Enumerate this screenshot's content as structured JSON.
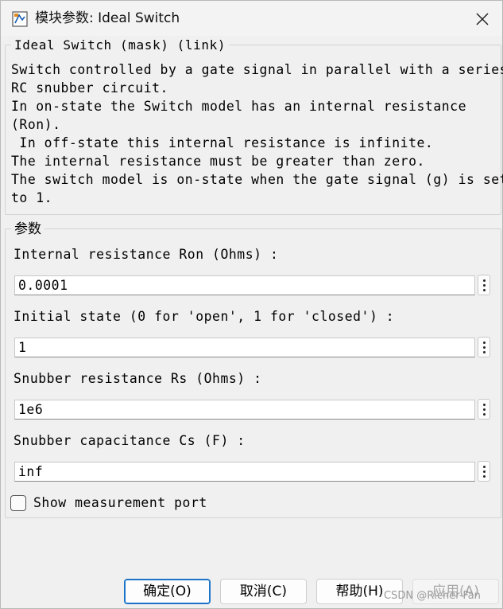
{
  "window": {
    "title": "模块参数: Ideal Switch",
    "icon": "simulink-block-icon",
    "close_icon": "close-icon"
  },
  "description": {
    "group_title": "Ideal Switch (mask) (link)",
    "lines": [
      "Switch controlled by a gate signal in parallel with a series",
      "RC snubber circuit.",
      "In on-state the Switch model has an internal resistance",
      "(Ron).",
      " In off-state this internal resistance is infinite.",
      "The internal resistance must be greater than zero.",
      "The switch model is on-state when the gate signal (g) is set",
      "to 1."
    ]
  },
  "parameters": {
    "group_title": "参数",
    "fields": [
      {
        "label": "Internal resistance Ron (Ohms) :",
        "value": "0.0001"
      },
      {
        "label": "Initial state (0 for 'open', 1 for 'closed') :",
        "value": "1"
      },
      {
        "label": "Snubber resistance Rs (Ohms) :",
        "value": "1e6"
      },
      {
        "label": "Snubber capacitance Cs (F) :",
        "value": "inf"
      }
    ],
    "checkbox": {
      "label": "Show measurement port",
      "checked": false
    }
  },
  "buttons": {
    "ok": "确定(O)",
    "cancel": "取消(C)",
    "help": "帮助(H)",
    "apply": "应用(A)"
  },
  "watermark": "CSDN @Richer-Fan",
  "colors": {
    "accent": "#1b74c9",
    "background": "#f0f0f0"
  }
}
